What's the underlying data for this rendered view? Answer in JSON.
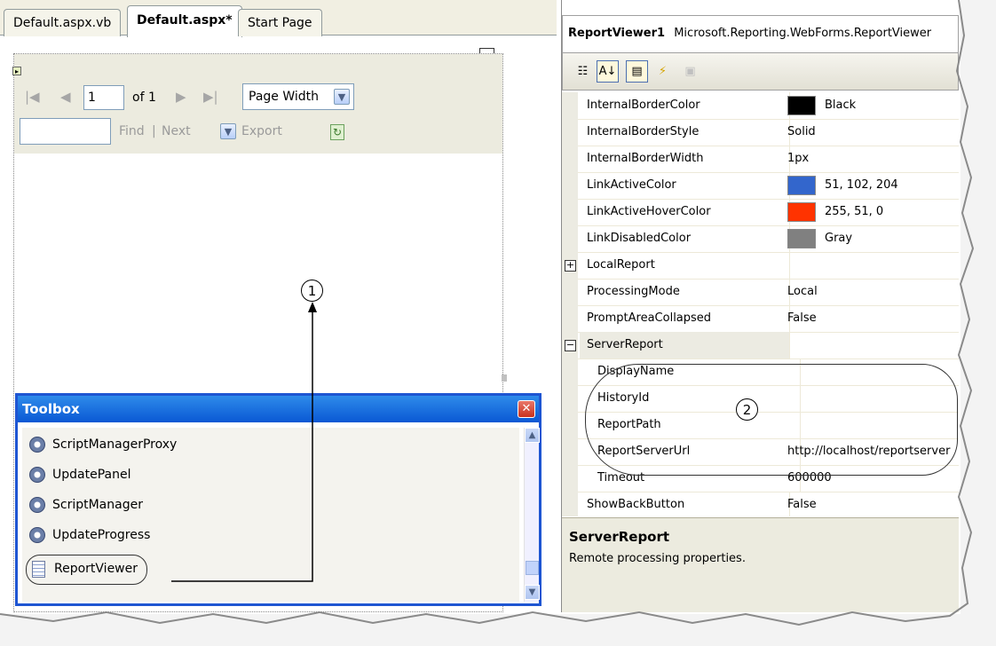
{
  "designer": {
    "tabs": [
      {
        "label": "Default.aspx.vb"
      },
      {
        "label": "Default.aspx*"
      },
      {
        "label": "Start Page"
      }
    ],
    "report_viewer": {
      "page_value": "1",
      "of_pages": "of 1",
      "zoom": "Page Width",
      "find_label": "Find",
      "separator": "|",
      "next_label": "Next",
      "export_label": "Export"
    }
  },
  "toolbox": {
    "title": "Toolbox",
    "items": [
      {
        "label": "ScriptManagerProxy",
        "icon": "gear-icon"
      },
      {
        "label": "UpdatePanel",
        "icon": "gear-icon"
      },
      {
        "label": "ScriptManager",
        "icon": "gear-icon"
      },
      {
        "label": "UpdateProgress",
        "icon": "gear-icon"
      },
      {
        "label": "ReportViewer",
        "icon": "report-viewer-icon"
      }
    ]
  },
  "properties": {
    "object_name": "ReportViewer1",
    "object_type": "Microsoft.Reporting.WebForms.ReportViewer",
    "rows": [
      {
        "name": "InternalBorderColor",
        "value": "Black",
        "swatch": "#000000"
      },
      {
        "name": "InternalBorderStyle",
        "value": "Solid"
      },
      {
        "name": "InternalBorderWidth",
        "value": "1px"
      },
      {
        "name": "LinkActiveColor",
        "value": "51, 102, 204",
        "swatch": "#3366cc"
      },
      {
        "name": "LinkActiveHoverColor",
        "value": "255, 51, 0",
        "swatch": "#ff3300"
      },
      {
        "name": "LinkDisabledColor",
        "value": "Gray",
        "swatch": "#808080"
      },
      {
        "name": "LocalReport",
        "value": "",
        "expander": "+"
      },
      {
        "name": "ProcessingMode",
        "value": "Local"
      },
      {
        "name": "PromptAreaCollapsed",
        "value": "False"
      },
      {
        "name": "ServerReport",
        "value": "",
        "expander": "−"
      },
      {
        "name": "DisplayName",
        "value": ""
      },
      {
        "name": "HistoryId",
        "value": ""
      },
      {
        "name": "ReportPath",
        "value": ""
      },
      {
        "name": "ReportServerUrl",
        "value": "http://localhost/reportserver"
      },
      {
        "name": "Timeout",
        "value": "600000"
      },
      {
        "name": "ShowBackButton",
        "value": "False"
      }
    ],
    "description": {
      "title": "ServerReport",
      "text": "Remote processing properties."
    }
  },
  "callouts": {
    "one": "1",
    "two": "2"
  }
}
